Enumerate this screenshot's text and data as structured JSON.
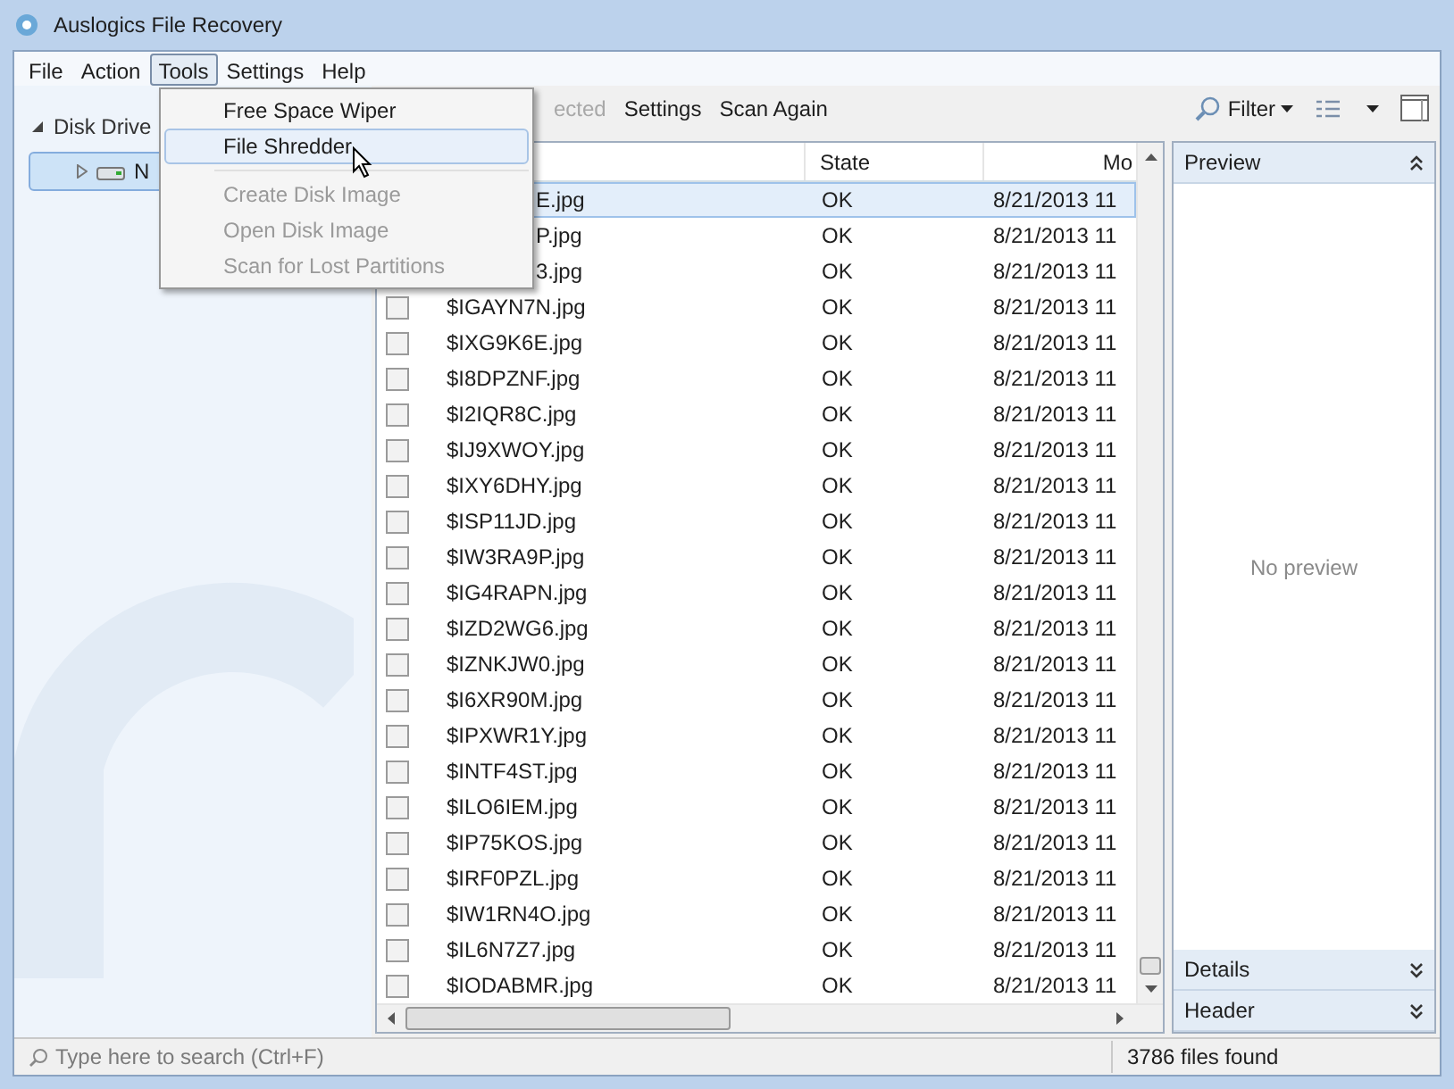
{
  "window": {
    "title": "Auslogics File Recovery"
  },
  "menu_bar": [
    {
      "label": "File",
      "selected": false
    },
    {
      "label": "Action",
      "selected": false
    },
    {
      "label": "Tools",
      "selected": true
    },
    {
      "label": "Settings",
      "selected": false
    },
    {
      "label": "Help",
      "selected": false
    }
  ],
  "tools_menu": {
    "groups": [
      [
        {
          "label": "Free Space Wiper",
          "disabled": false,
          "selected": false
        },
        {
          "label": "File Shredder",
          "disabled": false,
          "selected": true
        }
      ],
      [
        {
          "label": "Create Disk Image",
          "disabled": true,
          "selected": false
        },
        {
          "label": "Open Disk Image",
          "disabled": true,
          "selected": false
        },
        {
          "label": "Scan for Lost Partitions",
          "disabled": true,
          "selected": false
        }
      ]
    ]
  },
  "toolbar": {
    "items": [
      {
        "label": "ected",
        "disabled": true
      },
      {
        "label": "Settings",
        "disabled": false
      },
      {
        "label": "Scan Again",
        "disabled": false
      }
    ],
    "filter": "Filter"
  },
  "tree": {
    "root": {
      "label": "Disk Drive",
      "expanded": true,
      "children": [
        {
          "label": "N",
          "selected": true,
          "expanded": false
        }
      ]
    }
  },
  "table": {
    "columns": [
      "State",
      "Mo"
    ],
    "rows": [
      {
        "kind": "partial",
        "name": "E.jpg",
        "state": "OK",
        "modified": "8/21/2013 11",
        "selected": true
      },
      {
        "kind": "partial",
        "name": "P.jpg",
        "state": "OK",
        "modified": "8/21/2013 11",
        "selected": false
      },
      {
        "kind": "partial",
        "name": "3.jpg",
        "state": "OK",
        "modified": "8/21/2013 11",
        "selected": false
      },
      {
        "kind": "file",
        "name": "$IGAYN7N.jpg",
        "state": "OK",
        "modified": "8/21/2013 11",
        "checked": false,
        "selected": false
      },
      {
        "kind": "file",
        "name": "$IXG9K6E.jpg",
        "state": "OK",
        "modified": "8/21/2013 11",
        "checked": false,
        "selected": false
      },
      {
        "kind": "file",
        "name": "$I8DPZNF.jpg",
        "state": "OK",
        "modified": "8/21/2013 11",
        "checked": false,
        "selected": false
      },
      {
        "kind": "file",
        "name": "$I2IQR8C.jpg",
        "state": "OK",
        "modified": "8/21/2013 11",
        "checked": false,
        "selected": false
      },
      {
        "kind": "file",
        "name": "$IJ9XWOY.jpg",
        "state": "OK",
        "modified": "8/21/2013 11",
        "checked": false,
        "selected": false
      },
      {
        "kind": "file",
        "name": "$IXY6DHY.jpg",
        "state": "OK",
        "modified": "8/21/2013 11",
        "checked": false,
        "selected": false
      },
      {
        "kind": "file",
        "name": "$ISP11JD.jpg",
        "state": "OK",
        "modified": "8/21/2013 11",
        "checked": false,
        "selected": false
      },
      {
        "kind": "file",
        "name": "$IW3RA9P.jpg",
        "state": "OK",
        "modified": "8/21/2013 11",
        "checked": false,
        "selected": false
      },
      {
        "kind": "file",
        "name": "$IG4RAPN.jpg",
        "state": "OK",
        "modified": "8/21/2013 11",
        "checked": false,
        "selected": false
      },
      {
        "kind": "file",
        "name": "$IZD2WG6.jpg",
        "state": "OK",
        "modified": "8/21/2013 11",
        "checked": false,
        "selected": false
      },
      {
        "kind": "file",
        "name": "$IZNKJW0.jpg",
        "state": "OK",
        "modified": "8/21/2013 11",
        "checked": false,
        "selected": false
      },
      {
        "kind": "file",
        "name": "$I6XR90M.jpg",
        "state": "OK",
        "modified": "8/21/2013 11",
        "checked": false,
        "selected": false
      },
      {
        "kind": "file",
        "name": "$IPXWR1Y.jpg",
        "state": "OK",
        "modified": "8/21/2013 11",
        "checked": false,
        "selected": false
      },
      {
        "kind": "file",
        "name": "$INTF4ST.jpg",
        "state": "OK",
        "modified": "8/21/2013 11",
        "checked": false,
        "selected": false
      },
      {
        "kind": "file",
        "name": "$ILO6IEM.jpg",
        "state": "OK",
        "modified": "8/21/2013 11",
        "checked": false,
        "selected": false
      },
      {
        "kind": "file",
        "name": "$IP75KOS.jpg",
        "state": "OK",
        "modified": "8/21/2013 11",
        "checked": false,
        "selected": false
      },
      {
        "kind": "file",
        "name": "$IRF0PZL.jpg",
        "state": "OK",
        "modified": "8/21/2013 11",
        "checked": false,
        "selected": false
      },
      {
        "kind": "file",
        "name": "$IW1RN4O.jpg",
        "state": "OK",
        "modified": "8/21/2013 11",
        "checked": false,
        "selected": false
      },
      {
        "kind": "file",
        "name": "$IL6N7Z7.jpg",
        "state": "OK",
        "modified": "8/21/2013 11",
        "checked": false,
        "selected": false
      },
      {
        "kind": "file",
        "name": "$IODABMR.jpg",
        "state": "OK",
        "modified": "8/21/2013 11",
        "checked": false,
        "selected": false
      }
    ]
  },
  "side_panels": [
    {
      "title": "Preview",
      "expanded": true,
      "body": "No preview"
    },
    {
      "title": "Details",
      "expanded": false
    },
    {
      "title": "Header",
      "expanded": false
    }
  ],
  "status_bar": {
    "search_placeholder": "Type here to search (Ctrl+F)",
    "count": "3786 files found"
  }
}
